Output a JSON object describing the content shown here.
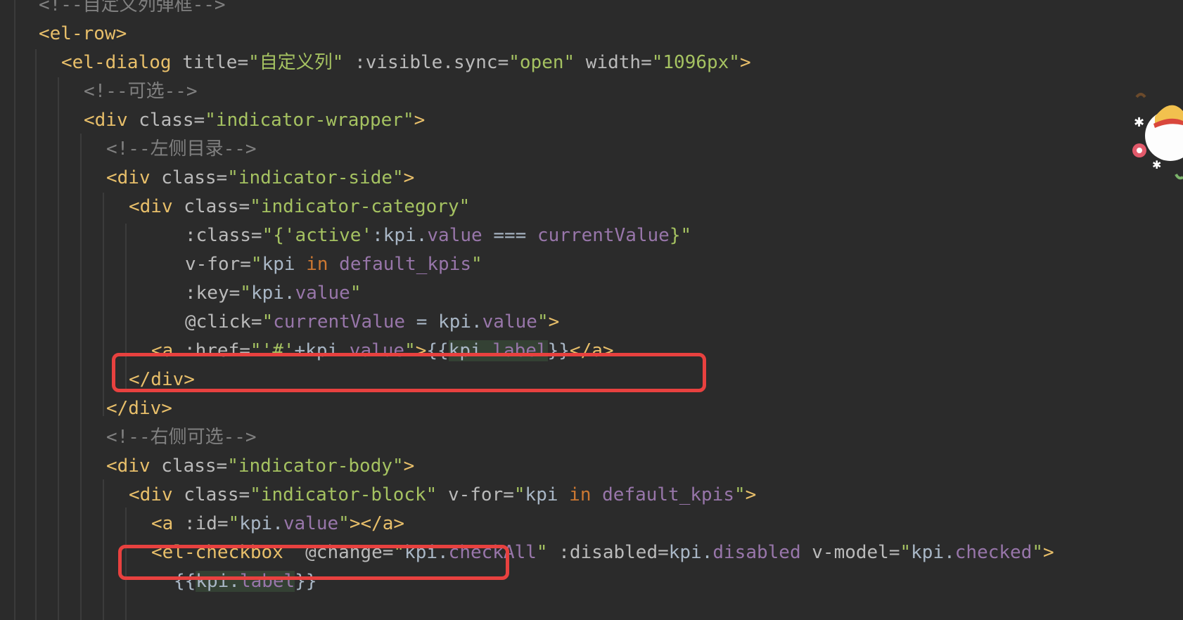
{
  "editor": {
    "language": "vue-template",
    "lines": [
      [
        {
          "text": "<!--自定义列弹框-->",
          "type": "com"
        }
      ],
      [
        {
          "text": "<el-row>",
          "type": "tag"
        }
      ],
      [
        {
          "text": "<el-dialog ",
          "type": "tag"
        },
        {
          "text": "title=",
          "type": "attr"
        },
        {
          "text": "\"自定义列\"",
          "type": "val"
        },
        {
          "text": " :visible.sync=",
          "type": "attr"
        },
        {
          "text": "\"open\"",
          "type": "val"
        },
        {
          "text": " width=",
          "type": "attr"
        },
        {
          "text": "\"1096px\"",
          "type": "val"
        },
        {
          "text": ">",
          "type": "tag"
        }
      ],
      [
        {
          "text": "<!--可选-->",
          "type": "com"
        }
      ],
      [
        {
          "text": "<div ",
          "type": "tag"
        },
        {
          "text": "class=",
          "type": "attr"
        },
        {
          "text": "\"indicator-wrapper\"",
          "type": "val"
        },
        {
          "text": ">",
          "type": "tag"
        }
      ],
      [
        {
          "text": "<!--左侧目录-->",
          "type": "com"
        }
      ],
      [
        {
          "text": "<div ",
          "type": "tag"
        },
        {
          "text": "class=",
          "type": "attr"
        },
        {
          "text": "\"indicator-side\"",
          "type": "val"
        },
        {
          "text": ">",
          "type": "tag"
        }
      ],
      [
        {
          "text": "<div ",
          "type": "tag"
        },
        {
          "text": "class=",
          "type": "attr"
        },
        {
          "text": "\"indicator-category\"",
          "type": "val"
        }
      ],
      [
        {
          "text": ":class=",
          "type": "attr"
        },
        {
          "text": "\"{",
          "type": "val"
        },
        {
          "text": "'active'",
          "type": "val"
        },
        {
          "text": ":kpi.",
          "type": "text"
        },
        {
          "text": "value",
          "type": "prop"
        },
        {
          "text": " === ",
          "type": "text"
        },
        {
          "text": "currentValue",
          "type": "prop"
        },
        {
          "text": "}\"",
          "type": "val"
        }
      ],
      [
        {
          "text": "v-for=",
          "type": "attr"
        },
        {
          "text": "\"",
          "type": "val"
        },
        {
          "text": "kpi ",
          "type": "text"
        },
        {
          "text": "in",
          "type": "kw"
        },
        {
          "text": " default_kpis",
          "type": "prop"
        },
        {
          "text": "\"",
          "type": "val"
        }
      ],
      [
        {
          "text": ":key=",
          "type": "attr"
        },
        {
          "text": "\"",
          "type": "val"
        },
        {
          "text": "kpi.",
          "type": "text"
        },
        {
          "text": "value",
          "type": "prop"
        },
        {
          "text": "\"",
          "type": "val"
        }
      ],
      [
        {
          "text": "@click=",
          "type": "attr"
        },
        {
          "text": "\"",
          "type": "val"
        },
        {
          "text": "currentValue",
          "type": "prop"
        },
        {
          "text": " = kpi.",
          "type": "text"
        },
        {
          "text": "value",
          "type": "prop"
        },
        {
          "text": "\"",
          "type": "val"
        },
        {
          "text": ">",
          "type": "tag"
        }
      ],
      [
        {
          "text": "<a ",
          "type": "tag"
        },
        {
          "text": ":href=",
          "type": "attr"
        },
        {
          "text": "\"'#'",
          "type": "val"
        },
        {
          "text": "+kpi.",
          "type": "text"
        },
        {
          "text": "value",
          "type": "prop"
        },
        {
          "text": "\"",
          "type": "val"
        },
        {
          "text": ">",
          "type": "tag"
        },
        {
          "text": "{{",
          "type": "text"
        },
        {
          "text": "kpi.",
          "type": "text",
          "hl": true
        },
        {
          "text": "label",
          "type": "prop",
          "hl": true
        },
        {
          "text": "}}",
          "type": "text"
        },
        {
          "text": "</a>",
          "type": "tag"
        }
      ],
      [
        {
          "text": "</div>",
          "type": "tag"
        }
      ],
      [
        {
          "text": "</div>",
          "type": "tag"
        }
      ],
      [
        {
          "text": "<!--右侧可选-->",
          "type": "com"
        }
      ],
      [
        {
          "text": "<div ",
          "type": "tag"
        },
        {
          "text": "class=",
          "type": "attr"
        },
        {
          "text": "\"indicator-body\"",
          "type": "val"
        },
        {
          "text": ">",
          "type": "tag"
        }
      ],
      [
        {
          "text": "<div ",
          "type": "tag"
        },
        {
          "text": "class=",
          "type": "attr"
        },
        {
          "text": "\"indicator-block\"",
          "type": "val"
        },
        {
          "text": " v-for=",
          "type": "attr"
        },
        {
          "text": "\"",
          "type": "val"
        },
        {
          "text": "kpi ",
          "type": "text"
        },
        {
          "text": "in",
          "type": "kw"
        },
        {
          "text": " default_kpis",
          "type": "prop"
        },
        {
          "text": "\"",
          "type": "val"
        },
        {
          "text": ">",
          "type": "tag"
        }
      ],
      [
        {
          "text": "<a ",
          "type": "tag"
        },
        {
          "text": ":id=",
          "type": "attr"
        },
        {
          "text": "\"",
          "type": "val"
        },
        {
          "text": "kpi.",
          "type": "text"
        },
        {
          "text": "value",
          "type": "prop"
        },
        {
          "text": "\"",
          "type": "val"
        },
        {
          "text": "></a>",
          "type": "tag"
        }
      ],
      [
        {
          "text": "<el-checkbox  ",
          "type": "tag"
        },
        {
          "text": "@change=",
          "type": "attr"
        },
        {
          "text": "\"",
          "type": "val"
        },
        {
          "text": "kpi.",
          "type": "text"
        },
        {
          "text": "checkAll",
          "type": "prop"
        },
        {
          "text": "\"",
          "type": "val"
        },
        {
          "text": " :disabled=",
          "type": "attr"
        },
        {
          "text": "kpi.",
          "type": "text"
        },
        {
          "text": "disabled",
          "type": "prop"
        },
        {
          "text": " v-model=",
          "type": "attr"
        },
        {
          "text": "\"",
          "type": "val"
        },
        {
          "text": "kpi.",
          "type": "text"
        },
        {
          "text": "checked",
          "type": "prop"
        },
        {
          "text": "\"",
          "type": "val"
        },
        {
          "text": ">",
          "type": "tag"
        }
      ],
      [
        {
          "text": "{{",
          "type": "text"
        },
        {
          "text": "kpi.",
          "type": "text",
          "hl": true
        },
        {
          "text": "label",
          "type": "prop",
          "hl": true
        },
        {
          "text": "}}",
          "type": "text"
        }
      ]
    ]
  },
  "annotations": [
    {
      "name": "highlight-box-anchor-link",
      "line_index": 12
    },
    {
      "name": "highlight-box-anchor-id",
      "line_index": 18
    }
  ],
  "colors": {
    "background": "#2b2b2b",
    "tag": "#e8bf6a",
    "attribute": "#bababa",
    "string": "#a5c261",
    "comment": "#808080",
    "text": "#a9b7c6",
    "property": "#9876aa",
    "keyword": "#cc7832",
    "annotation_border": "#e8413f"
  },
  "mascot": {
    "icon": "anime-mascot-icon"
  }
}
